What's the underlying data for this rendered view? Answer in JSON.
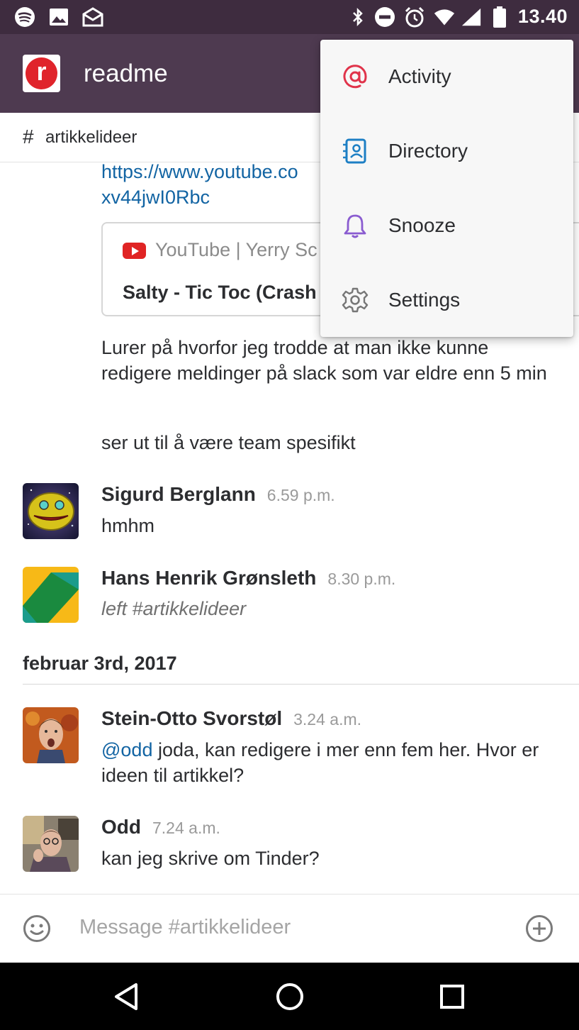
{
  "status_bar": {
    "time": "13.40",
    "icons": [
      "spotify-icon",
      "image-icon",
      "mail-icon",
      "bluetooth-icon",
      "do-not-disturb-icon",
      "alarm-icon",
      "wifi-icon",
      "signal-icon",
      "battery-icon"
    ]
  },
  "app_bar": {
    "logo_letter": "r",
    "team_name": "readme"
  },
  "channel": {
    "hash": "#",
    "name": "artikkelideer"
  },
  "messages": {
    "link_line1": "https://www.youtube.co",
    "link_line2": "xv44jwI0Rbc",
    "card": {
      "source": "YouTube | Yerry Sc",
      "title": "Salty - Tic Toc (Crash"
    },
    "text1": "Lurer på hvorfor jeg trodde at man ikke kunne redigere meldinger på slack som var eldre enn 5 min",
    "text2": "ser ut til å være team spesifikt",
    "msg_sigurd": {
      "user": "Sigurd Berglann",
      "time": "6.59 p.m.",
      "text": "hmhm"
    },
    "msg_hans": {
      "user": "Hans Henrik Grønsleth",
      "time": "8.30 p.m.",
      "text": "left #artikkelideer"
    },
    "day_divider": "februar 3rd, 2017",
    "msg_stein": {
      "user": "Stein-Otto Svorstøl",
      "time": "3.24 a.m.",
      "mention": "@odd",
      "text": " joda, kan redigere i mer enn fem her. Hvor er ideen til artikkel?"
    },
    "msg_odd": {
      "user": "Odd",
      "time": "7.24 a.m.",
      "text": "kan jeg skrive om Tinder?"
    }
  },
  "composer": {
    "placeholder": "Message #artikkelideer"
  },
  "menu": {
    "items": [
      {
        "label": "Activity",
        "icon": "at-icon"
      },
      {
        "label": "Directory",
        "icon": "directory-icon"
      },
      {
        "label": "Snooze",
        "icon": "bell-icon"
      },
      {
        "label": "Settings",
        "icon": "gear-icon"
      }
    ]
  },
  "colors": {
    "app_bar": "#4e3a50",
    "status_bar": "#3e2c3f",
    "link": "#1264a3",
    "activity_icon": "#e0334a",
    "directory_icon": "#1d7fc4",
    "snooze_icon": "#8a5cd0"
  }
}
